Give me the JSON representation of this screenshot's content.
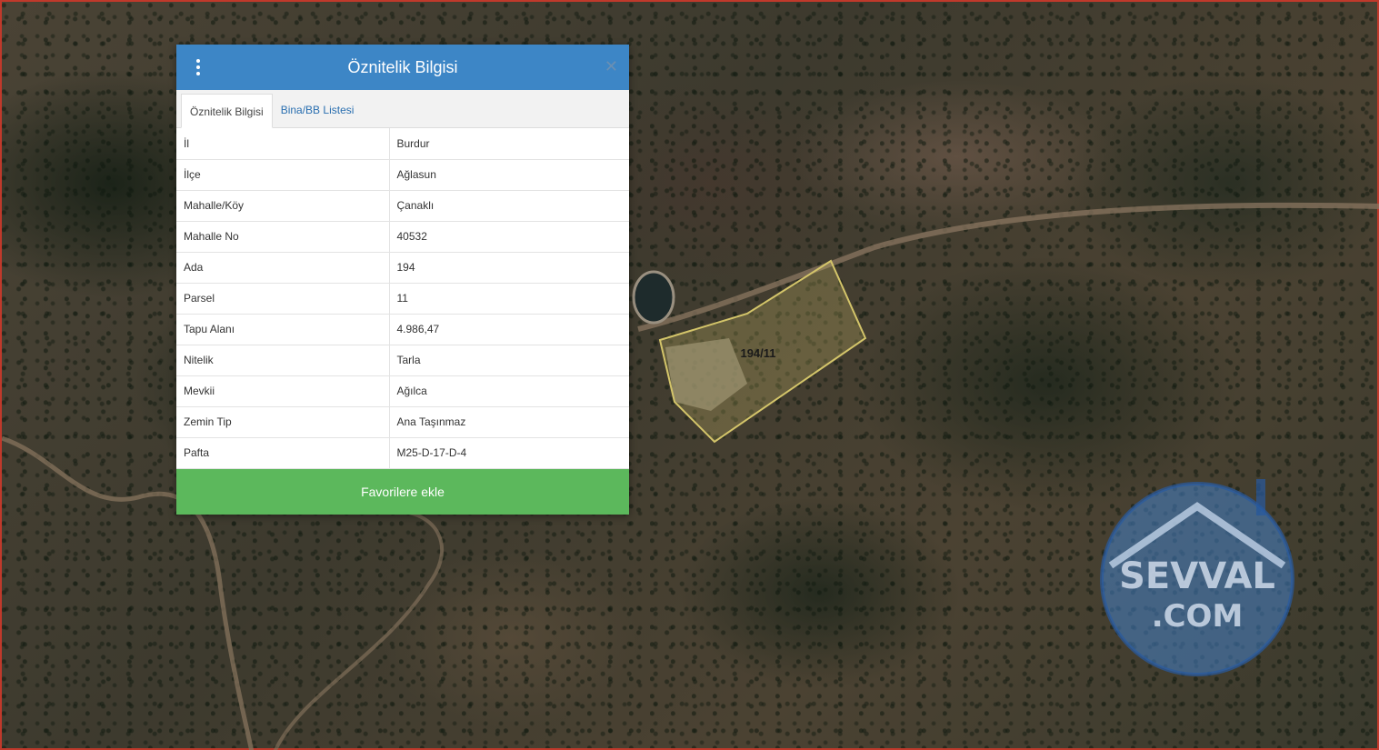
{
  "map": {
    "parcel_label": "194/11",
    "watermark_text_1": "SEVVAL",
    "watermark_text_2": ".COM"
  },
  "panel": {
    "title": "Öznitelik Bilgisi",
    "tabs": [
      {
        "label": "Öznitelik Bilgisi",
        "active": true
      },
      {
        "label": "Bina/BB Listesi",
        "active": false
      }
    ],
    "rows": [
      {
        "key": "İl",
        "value": "Burdur"
      },
      {
        "key": "İlçe",
        "value": "Ağlasun"
      },
      {
        "key": "Mahalle/Köy",
        "value": "Çanaklı"
      },
      {
        "key": "Mahalle No",
        "value": "40532"
      },
      {
        "key": "Ada",
        "value": "194"
      },
      {
        "key": "Parsel",
        "value": "11"
      },
      {
        "key": "Tapu Alanı",
        "value": "4.986,47"
      },
      {
        "key": "Nitelik",
        "value": "Tarla"
      },
      {
        "key": "Mevkii",
        "value": "Ağılca"
      },
      {
        "key": "Zemin Tip",
        "value": "Ana Taşınmaz"
      },
      {
        "key": "Pafta",
        "value": "M25-D-17-D-4"
      }
    ],
    "favorite_button": "Favorilere ekle",
    "close_symbol": "✕"
  },
  "colors": {
    "header_blue": "#3d86c6",
    "button_green": "#5cb85c",
    "parcel_outline": "#d4c56a",
    "map_border": "#c0392b"
  }
}
